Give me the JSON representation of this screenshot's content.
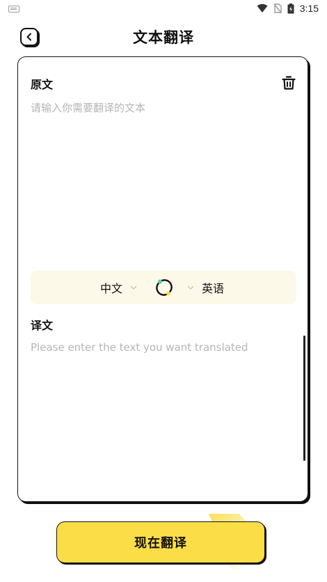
{
  "status_bar": {
    "time": "3:15",
    "icons": [
      "keyboard-icon",
      "wifi-icon",
      "no-sim-icon",
      "battery-icon"
    ]
  },
  "header": {
    "title": "文本翻译",
    "back_icon": "chevron-left-icon"
  },
  "source": {
    "label": "原文",
    "placeholder": "请输入你需要翻译的文本",
    "value": "",
    "clear_icon": "trash-icon"
  },
  "language": {
    "from": "中文",
    "to": "英语",
    "swap_icon": "swap-icon"
  },
  "target": {
    "label": "译文",
    "placeholder": "Please enter the text you want translated",
    "value": ""
  },
  "action": {
    "translate_label": "现在翻译"
  },
  "colors": {
    "accent": "#fbdd47",
    "lang_bar_bg": "#fdf9e9",
    "border": "#111111",
    "placeholder": "#b5b5b5"
  }
}
